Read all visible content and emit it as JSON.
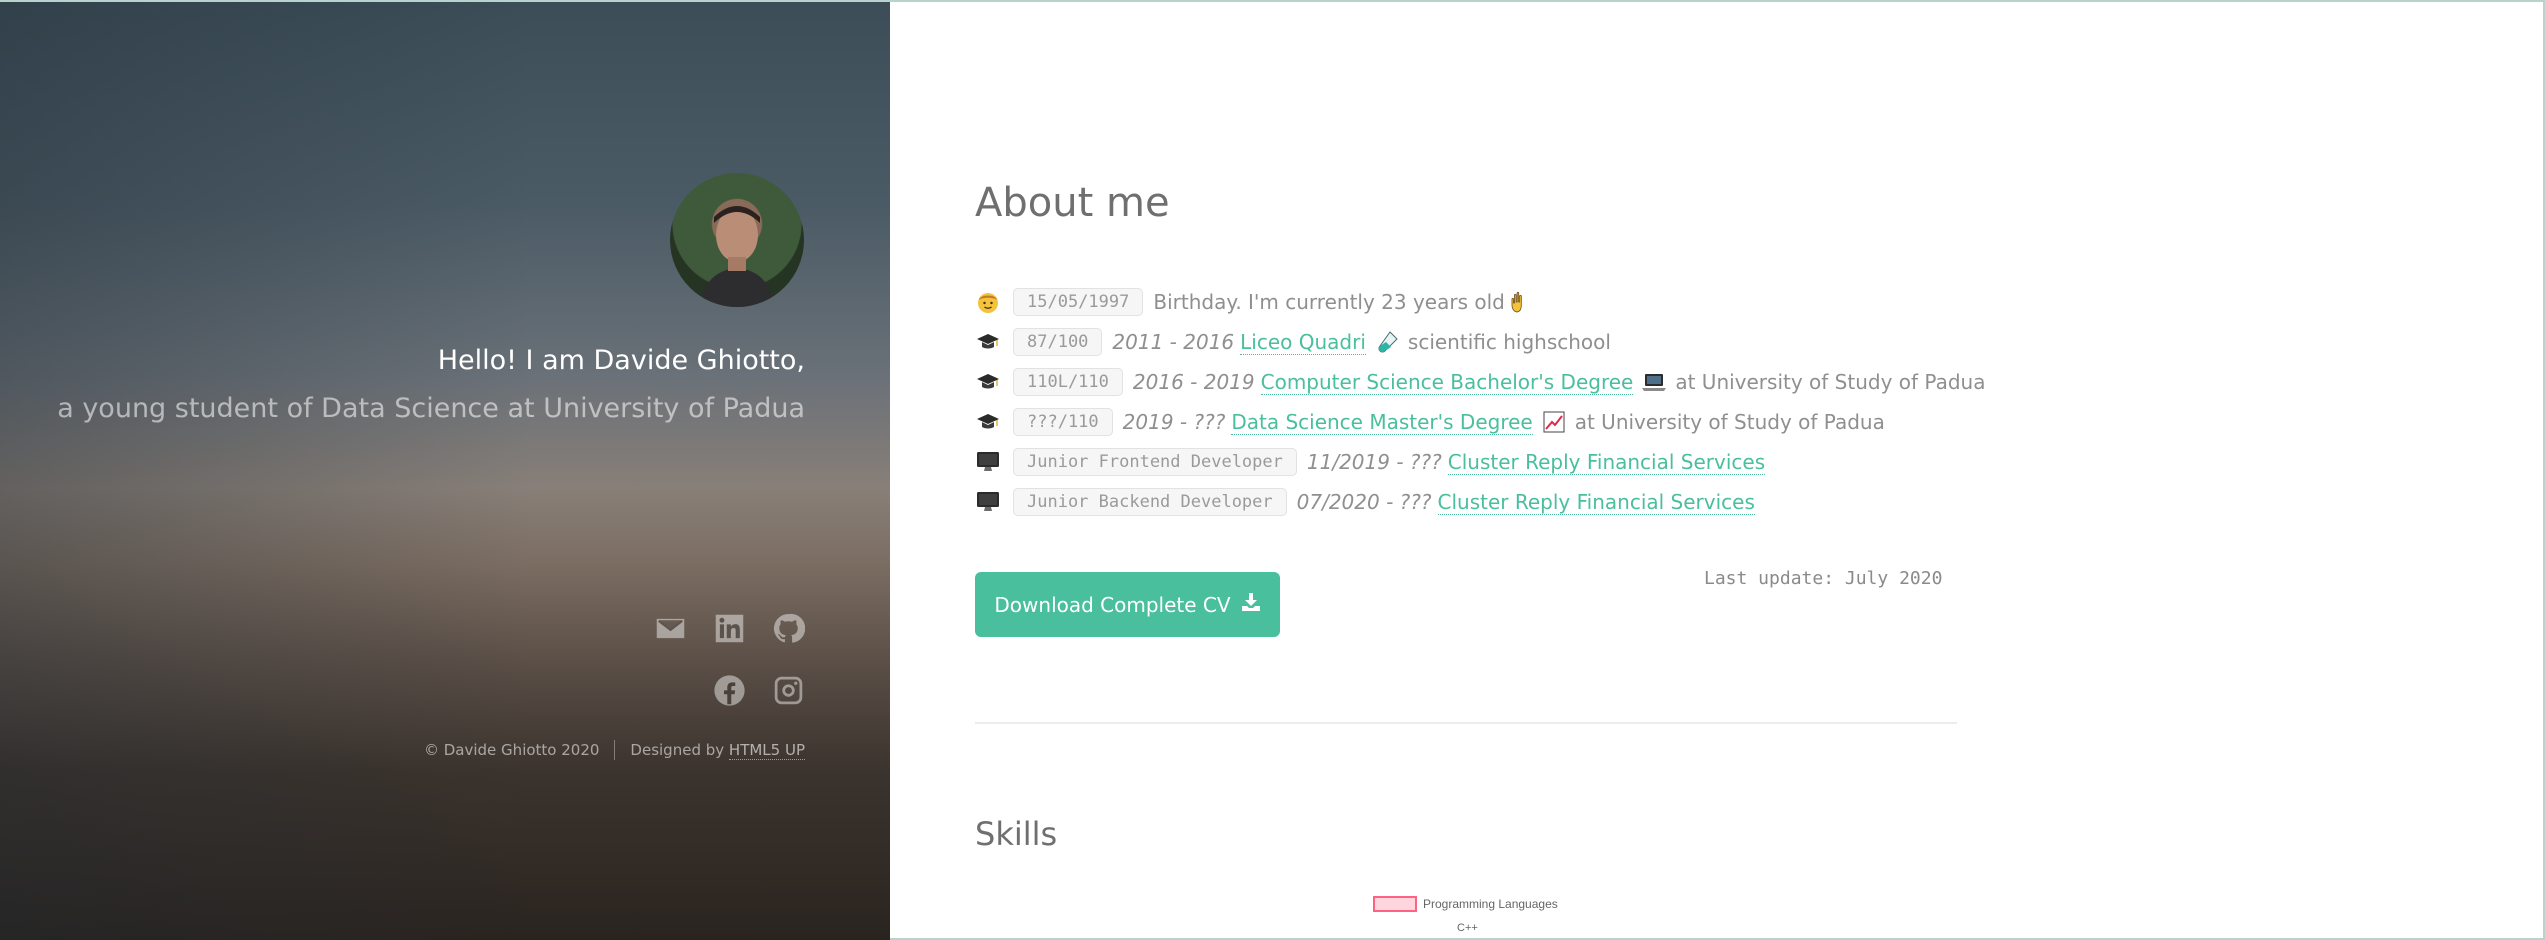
{
  "header": {
    "hello": "Hello! I am Davide Ghiotto,",
    "subtitle": "a young student of Data Science at University of Padua",
    "social_icons": [
      "envelope-icon",
      "linkedin-icon",
      "github-icon",
      "facebook-icon",
      "instagram-icon"
    ],
    "copyright": "© Davide Ghiotto 2020",
    "designed_by": "Designed by",
    "designer_link": "HTML5 UP"
  },
  "about": {
    "title": "About me",
    "rows": [
      {
        "emoji": "boy-face-icon",
        "tag": "15/05/1997",
        "text": "Birthday. I'm currently 23 years old"
      },
      {
        "emoji": "graduation-cap-icon",
        "tag": "87/100",
        "dates": "2011 - 2016",
        "link": "Liceo Quadri",
        "text": "scientific highschool"
      },
      {
        "emoji": "graduation-cap-icon",
        "tag": "110L/110",
        "dates": "2016 - 2019",
        "link": "Computer Science Bachelor's Degree",
        "text": "at University of Study of Padua"
      },
      {
        "emoji": "graduation-cap-icon",
        "tag": "???/110",
        "dates": "2019 - ???",
        "link": "Data Science Master's Degree",
        "text": "at University of Study of Padua"
      },
      {
        "emoji": "computer-icon",
        "tag": "Junior Frontend Developer",
        "dates": "11/2019 - ???",
        "link": "Cluster Reply Financial Services"
      },
      {
        "emoji": "computer-icon",
        "tag": "Junior Backend Developer",
        "dates": "07/2020 - ???",
        "link": "Cluster Reply Financial Services"
      }
    ],
    "cv_button": "Download Complete CV",
    "last_update": "Last update: July 2020"
  },
  "skills": {
    "title": "Skills",
    "legend": "Programming Languages",
    "first_tick": "C++",
    "colors": {
      "fill": "#ffd6de",
      "stroke": "#ff6384"
    }
  },
  "colors": {
    "accent": "#49bf9d"
  }
}
